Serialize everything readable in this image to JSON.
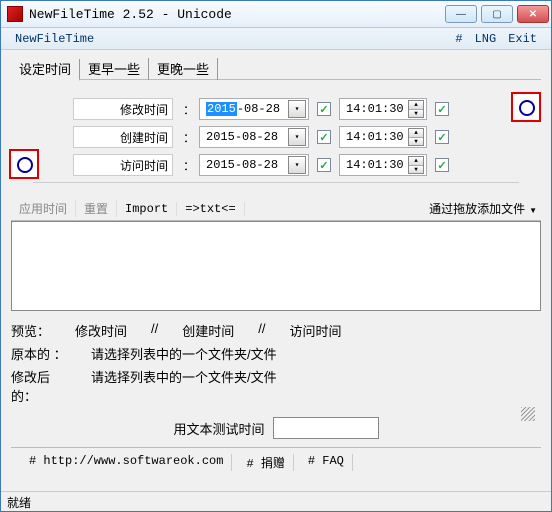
{
  "window": {
    "title": "NewFileTime 2.52 - Unicode"
  },
  "menubar": {
    "app": "NewFileTime",
    "hash": "#",
    "lng": "LNG",
    "exit": "Exit"
  },
  "tabs": {
    "set": "设定时间",
    "earlier": "更早一些",
    "later": "更晚一些"
  },
  "rows": {
    "modified": {
      "label": "修改时间",
      "year": "2015",
      "date_rest": "-08-28",
      "time": "14:01:30"
    },
    "created": {
      "label": "创建时间",
      "date": "2015-08-28",
      "time": "14:01:30"
    },
    "accessed": {
      "label": "访问时间",
      "date": "2015-08-28",
      "time": "14:01:30"
    }
  },
  "toolbar": {
    "apply": "应用时间",
    "reset": "重置",
    "import": "Import",
    "txt": "=>txt<=",
    "dropfiles": "通过拖放添加文件"
  },
  "preview": {
    "label": "预览：",
    "modified": "修改时间",
    "created": "创建时间",
    "accessed": "访问时间",
    "sep": "//",
    "orig_label": "原本的 ：",
    "after_label": "修改后的：",
    "hint": "请选择列表中的一个文件夹/文件"
  },
  "test": {
    "label": "用文本测试时间"
  },
  "footer": {
    "url": "# http://www.softwareok.com",
    "donate": "# 捐赠",
    "faq": "# FAQ"
  },
  "status": "就绪"
}
